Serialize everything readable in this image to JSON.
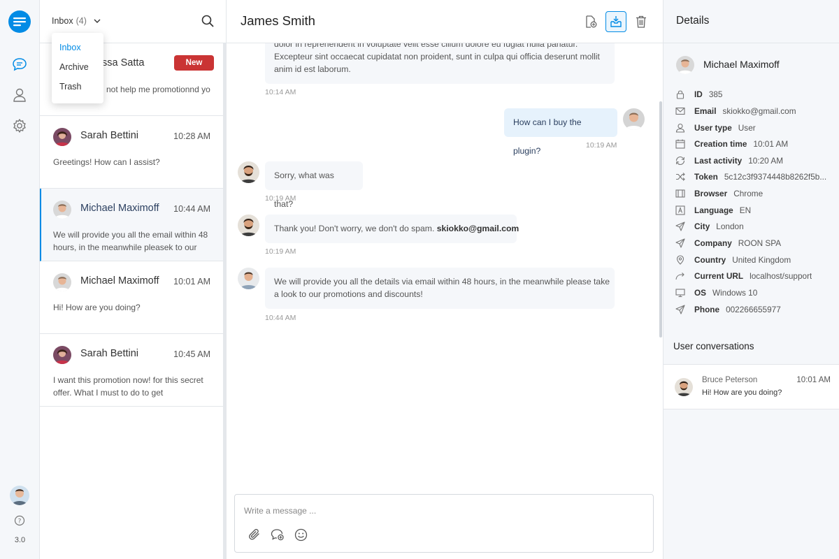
{
  "rail": {
    "items": [
      {
        "name": "conversations-icon",
        "active": true
      },
      {
        "name": "users-icon",
        "active": false
      },
      {
        "name": "settings-icon",
        "active": false
      }
    ],
    "version": "3.0"
  },
  "convlist": {
    "filter_label": "Inbox",
    "filter_count": "(4)",
    "dropdown": [
      "Inbox",
      "Archive",
      "Trash"
    ],
    "conversations": [
      {
        "name": "Melissa Satta",
        "visible_name": "ssa Satta",
        "badge": "New",
        "message": "not help me  promotionnd yo"
      },
      {
        "name": "Sarah Bettini",
        "time": "10:28 AM",
        "message": "Greetings! How can I assist?"
      },
      {
        "name": "Michael Maximoff",
        "time": "10:44 AM",
        "message": "We will provide you all the  email within 48 hours, in the meanwhile pleasek to our"
      },
      {
        "name": "Michael Maximoff",
        "time": "10:01 AM",
        "message": "Hi! How are you doing?"
      },
      {
        "name": "Sarah Bettini",
        "time": "10:45 AM",
        "message": "I want this promotion now! for this secret offer. What I must to do to get"
      }
    ]
  },
  "chat": {
    "title": "James Smith",
    "messages": [
      {
        "from": "agent",
        "text_lines": [
          "dolor in reprehenderit in voluptate velit esse cillum dolore eu fugiat nulla pariatur.",
          "Excepteur sint occaecat cupidatat non proident, sunt in culpa qui officia deserunt mollit",
          "anim id est laborum."
        ],
        "time": "10:14 AM"
      },
      {
        "from": "user",
        "text": "How can I buy the plugin?",
        "time": "10:19 AM"
      },
      {
        "from": "agent",
        "text": "Sorry, what was that?",
        "time": "10:19 AM"
      },
      {
        "from": "agent",
        "text": "Thank you! Don't worry, we don't do spam. ",
        "bold": "skiokko@gmail.com",
        "time": "10:19 AM"
      },
      {
        "from": "agent",
        "text_lines": [
          "We will provide you all the details via email within 48 hours, in the meanwhile please take",
          "a look to our promotions and discounts!"
        ],
        "time": "10:44 AM"
      }
    ],
    "editor_placeholder": "Write a message ..."
  },
  "details": {
    "title": "Details",
    "name": "Michael Maximoff",
    "rows": [
      {
        "icon": "lock-icon",
        "key": "ID",
        "value": "385"
      },
      {
        "icon": "email-icon",
        "key": "Email",
        "value": "skiokko@gmail.com"
      },
      {
        "icon": "user-icon",
        "key": "User type",
        "value": "User"
      },
      {
        "icon": "calendar-icon",
        "key": "Creation time",
        "value": "10:01 AM"
      },
      {
        "icon": "refresh-icon",
        "key": "Last activity",
        "value": "10:20 AM"
      },
      {
        "icon": "shuffle-icon",
        "key": "Token",
        "value": "5c12c3f9374448b8262f5b..."
      },
      {
        "icon": "browser-icon",
        "key": "Browser",
        "value": "Chrome"
      },
      {
        "icon": "language-icon",
        "key": "Language",
        "value": "EN"
      },
      {
        "icon": "send-icon",
        "key": "City",
        "value": "London"
      },
      {
        "icon": "send-icon",
        "key": "Company",
        "value": "ROON SPA"
      },
      {
        "icon": "location-pin-icon",
        "key": "Country",
        "value": "United Kingdom"
      },
      {
        "icon": "redirect-arrow-icon",
        "key": "Current URL",
        "value": "localhost/support"
      },
      {
        "icon": "monitor-icon",
        "key": "OS",
        "value": "Windows 10"
      },
      {
        "icon": "send-icon",
        "key": "Phone",
        "value": "002266655977"
      }
    ],
    "user_conversations_title": "User conversations",
    "user_conversations": [
      {
        "name": "Bruce Peterson",
        "time": "10:01 AM",
        "message": "Hi! How are you doing?"
      }
    ]
  },
  "colors": {
    "accent": "#028be5",
    "badge": "#ca3434",
    "panel": "#f5f7fa",
    "user_bubble": "#e6f2fc"
  }
}
